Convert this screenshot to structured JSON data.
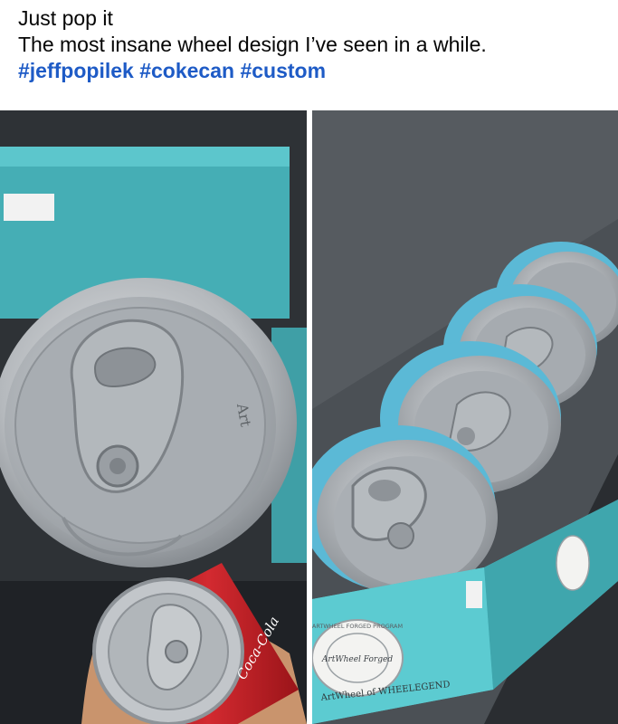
{
  "post": {
    "line1": "Just pop it",
    "line2": "The most insane wheel design I’ve seen in a while.",
    "hashtags": [
      "#jeffpopilek",
      "#cokecan",
      "#custom"
    ]
  },
  "photos": {
    "left": {
      "wheel_lettering": "Art",
      "can_lettering": "Coca-Cola"
    },
    "right": {
      "box_text": "ArtWheel of WHEELEGEND",
      "seal_ring_text": "ARTWHEEL FORGED PROGRAM",
      "seal_center_text": "ArtWheel Forged"
    }
  },
  "colors": {
    "hashtag": "#1e5bc6",
    "box_teal": "#4fbcc2",
    "can_red": "#c8222a",
    "wheel_silver": "#b9bdc1"
  }
}
